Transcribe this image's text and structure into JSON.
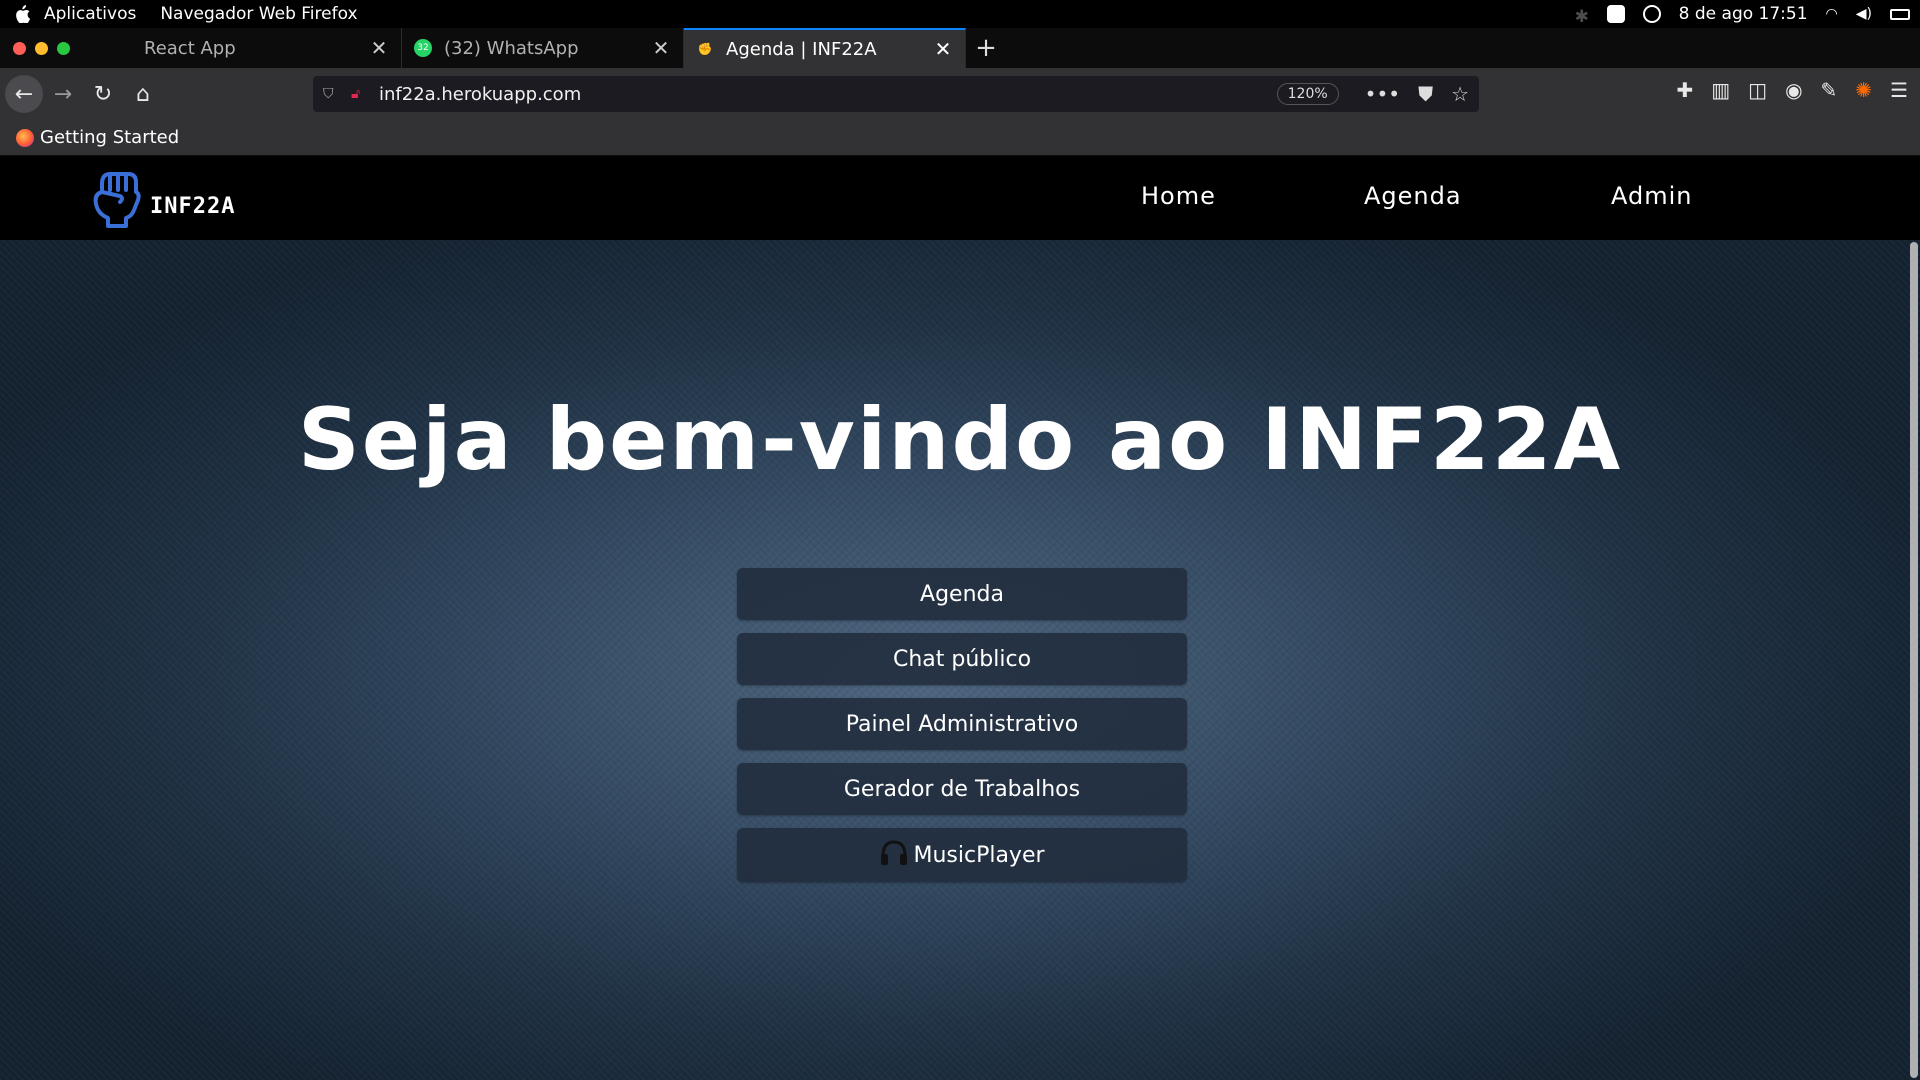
{
  "os": {
    "menu": [
      "Aplicativos",
      "Navegador Web Firefox"
    ],
    "datetime": "8 de ago  17:51"
  },
  "browser": {
    "tabs": [
      {
        "title": "React App",
        "active": false
      },
      {
        "title": "(32) WhatsApp",
        "active": false,
        "badge": "32"
      },
      {
        "title": "Agenda | INF22A",
        "active": true
      }
    ],
    "url": "inf22a.herokuapp.com",
    "zoom": "120%",
    "bookmarks": [
      "Getting Started"
    ]
  },
  "site": {
    "logo_text": "INF22A",
    "nav": [
      "Home",
      "Agenda",
      "Admin"
    ],
    "hero_title": "Seja bem-vindo ao INF22A",
    "buttons": [
      "Agenda",
      "Chat público",
      "Painel Administrativo",
      "Gerador de Trabalhos",
      "MusicPlayer"
    ]
  },
  "colors": {
    "accent": "#0a84ff",
    "site_nav_bg": "#000000",
    "logo_blue": "#3a6fd8",
    "hero_bg": "#344b63"
  }
}
